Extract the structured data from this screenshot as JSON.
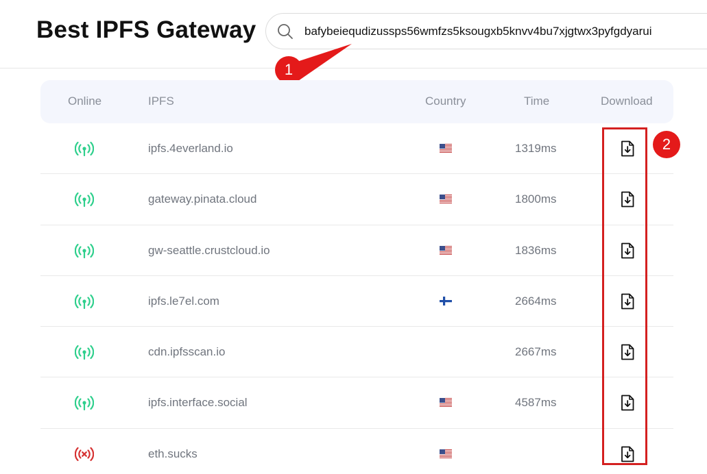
{
  "header": {
    "title": "Best IPFS Gateway",
    "search_value": "bafybeiequdizussps56wmfzs5ksougxb5knvv4bu7xjgtwx3pyfgdyarui"
  },
  "annotations": {
    "badge1": "1",
    "badge2": "2",
    "highlight_color": "#d42020"
  },
  "table": {
    "columns": {
      "online": "Online",
      "ipfs": "IPFS",
      "country": "Country",
      "time": "Time",
      "download": "Download"
    },
    "rows": [
      {
        "online": true,
        "host": "ipfs.4everland.io",
        "flag": "us",
        "time": "1319ms"
      },
      {
        "online": true,
        "host": "gateway.pinata.cloud",
        "flag": "us",
        "time": "1800ms"
      },
      {
        "online": true,
        "host": "gw-seattle.crustcloud.io",
        "flag": "us",
        "time": "1836ms"
      },
      {
        "online": true,
        "host": "ipfs.le7el.com",
        "flag": "fi",
        "time": "2664ms"
      },
      {
        "online": true,
        "host": "cdn.ipfsscan.io",
        "flag": "",
        "time": "2667ms"
      },
      {
        "online": true,
        "host": "ipfs.interface.social",
        "flag": "us",
        "time": "4587ms"
      },
      {
        "online": false,
        "host": "eth.sucks",
        "flag": "us",
        "time": ""
      }
    ]
  },
  "colors": {
    "online": "#2ecf8c",
    "offline": "#d63232"
  },
  "icons": {
    "search": "search-icon",
    "online": "signal-online-icon",
    "offline": "signal-offline-icon",
    "download": "file-download-icon"
  }
}
